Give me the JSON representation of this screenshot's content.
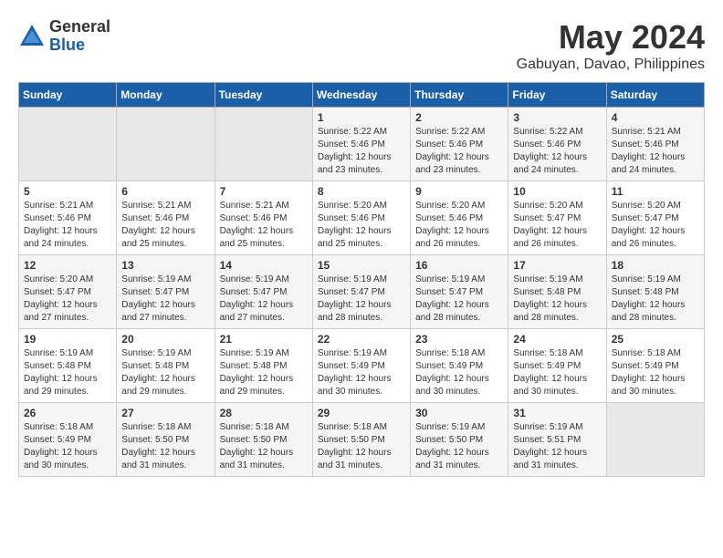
{
  "logo": {
    "general": "General",
    "blue": "Blue"
  },
  "title": "May 2024",
  "location": "Gabuyan, Davao, Philippines",
  "days_of_week": [
    "Sunday",
    "Monday",
    "Tuesday",
    "Wednesday",
    "Thursday",
    "Friday",
    "Saturday"
  ],
  "weeks": [
    [
      {
        "day": "",
        "info": ""
      },
      {
        "day": "",
        "info": ""
      },
      {
        "day": "",
        "info": ""
      },
      {
        "day": "1",
        "info": "Sunrise: 5:22 AM\nSunset: 5:46 PM\nDaylight: 12 hours\nand 23 minutes."
      },
      {
        "day": "2",
        "info": "Sunrise: 5:22 AM\nSunset: 5:46 PM\nDaylight: 12 hours\nand 23 minutes."
      },
      {
        "day": "3",
        "info": "Sunrise: 5:22 AM\nSunset: 5:46 PM\nDaylight: 12 hours\nand 24 minutes."
      },
      {
        "day": "4",
        "info": "Sunrise: 5:21 AM\nSunset: 5:46 PM\nDaylight: 12 hours\nand 24 minutes."
      }
    ],
    [
      {
        "day": "5",
        "info": "Sunrise: 5:21 AM\nSunset: 5:46 PM\nDaylight: 12 hours\nand 24 minutes."
      },
      {
        "day": "6",
        "info": "Sunrise: 5:21 AM\nSunset: 5:46 PM\nDaylight: 12 hours\nand 25 minutes."
      },
      {
        "day": "7",
        "info": "Sunrise: 5:21 AM\nSunset: 5:46 PM\nDaylight: 12 hours\nand 25 minutes."
      },
      {
        "day": "8",
        "info": "Sunrise: 5:20 AM\nSunset: 5:46 PM\nDaylight: 12 hours\nand 25 minutes."
      },
      {
        "day": "9",
        "info": "Sunrise: 5:20 AM\nSunset: 5:46 PM\nDaylight: 12 hours\nand 26 minutes."
      },
      {
        "day": "10",
        "info": "Sunrise: 5:20 AM\nSunset: 5:47 PM\nDaylight: 12 hours\nand 26 minutes."
      },
      {
        "day": "11",
        "info": "Sunrise: 5:20 AM\nSunset: 5:47 PM\nDaylight: 12 hours\nand 26 minutes."
      }
    ],
    [
      {
        "day": "12",
        "info": "Sunrise: 5:20 AM\nSunset: 5:47 PM\nDaylight: 12 hours\nand 27 minutes."
      },
      {
        "day": "13",
        "info": "Sunrise: 5:19 AM\nSunset: 5:47 PM\nDaylight: 12 hours\nand 27 minutes."
      },
      {
        "day": "14",
        "info": "Sunrise: 5:19 AM\nSunset: 5:47 PM\nDaylight: 12 hours\nand 27 minutes."
      },
      {
        "day": "15",
        "info": "Sunrise: 5:19 AM\nSunset: 5:47 PM\nDaylight: 12 hours\nand 28 minutes."
      },
      {
        "day": "16",
        "info": "Sunrise: 5:19 AM\nSunset: 5:47 PM\nDaylight: 12 hours\nand 28 minutes."
      },
      {
        "day": "17",
        "info": "Sunrise: 5:19 AM\nSunset: 5:48 PM\nDaylight: 12 hours\nand 28 minutes."
      },
      {
        "day": "18",
        "info": "Sunrise: 5:19 AM\nSunset: 5:48 PM\nDaylight: 12 hours\nand 28 minutes."
      }
    ],
    [
      {
        "day": "19",
        "info": "Sunrise: 5:19 AM\nSunset: 5:48 PM\nDaylight: 12 hours\nand 29 minutes."
      },
      {
        "day": "20",
        "info": "Sunrise: 5:19 AM\nSunset: 5:48 PM\nDaylight: 12 hours\nand 29 minutes."
      },
      {
        "day": "21",
        "info": "Sunrise: 5:19 AM\nSunset: 5:48 PM\nDaylight: 12 hours\nand 29 minutes."
      },
      {
        "day": "22",
        "info": "Sunrise: 5:19 AM\nSunset: 5:49 PM\nDaylight: 12 hours\nand 30 minutes."
      },
      {
        "day": "23",
        "info": "Sunrise: 5:18 AM\nSunset: 5:49 PM\nDaylight: 12 hours\nand 30 minutes."
      },
      {
        "day": "24",
        "info": "Sunrise: 5:18 AM\nSunset: 5:49 PM\nDaylight: 12 hours\nand 30 minutes."
      },
      {
        "day": "25",
        "info": "Sunrise: 5:18 AM\nSunset: 5:49 PM\nDaylight: 12 hours\nand 30 minutes."
      }
    ],
    [
      {
        "day": "26",
        "info": "Sunrise: 5:18 AM\nSunset: 5:49 PM\nDaylight: 12 hours\nand 30 minutes."
      },
      {
        "day": "27",
        "info": "Sunrise: 5:18 AM\nSunset: 5:50 PM\nDaylight: 12 hours\nand 31 minutes."
      },
      {
        "day": "28",
        "info": "Sunrise: 5:18 AM\nSunset: 5:50 PM\nDaylight: 12 hours\nand 31 minutes."
      },
      {
        "day": "29",
        "info": "Sunrise: 5:18 AM\nSunset: 5:50 PM\nDaylight: 12 hours\nand 31 minutes."
      },
      {
        "day": "30",
        "info": "Sunrise: 5:19 AM\nSunset: 5:50 PM\nDaylight: 12 hours\nand 31 minutes."
      },
      {
        "day": "31",
        "info": "Sunrise: 5:19 AM\nSunset: 5:51 PM\nDaylight: 12 hours\nand 31 minutes."
      },
      {
        "day": "",
        "info": ""
      }
    ]
  ]
}
